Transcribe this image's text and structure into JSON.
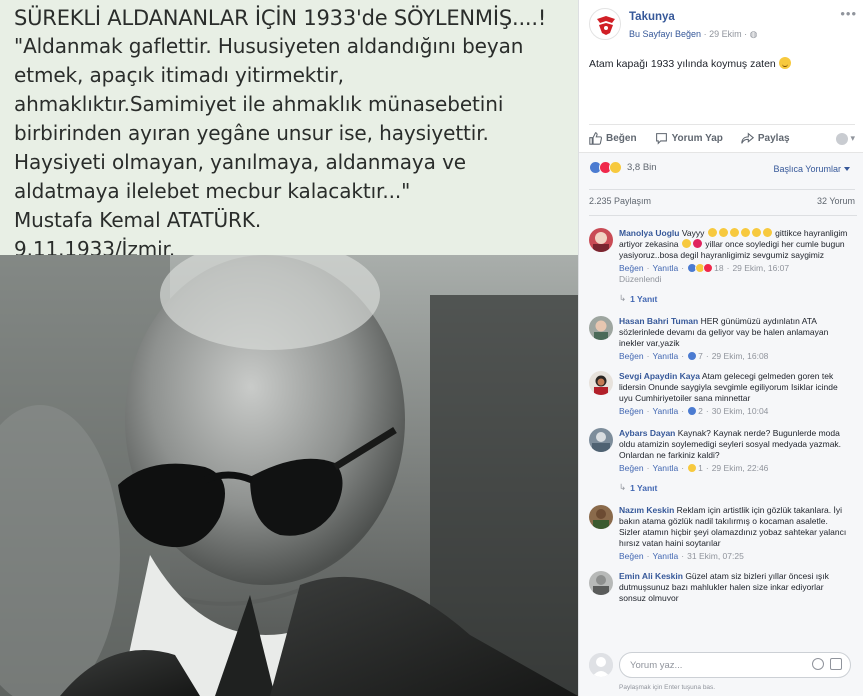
{
  "quote": {
    "heading": "SÜREKLİ ALDANANLAR İÇİN 1933'de SÖYLENMİŞ....!",
    "lines": [
      "\"Aldanmak gaflettir. Hususiyeten aldandığını beyan",
      "etmek, apaçık itimadı yitirmektir,",
      "ahmaklıktır.Samimiyet ile ahmaklık münasebetini",
      "birbirinden ayıran yegâne unsur ise, haysiyettir.",
      "Haysiyeti olmayan, yanılmaya, aldanmaya ve",
      "aldatmaya ilelebet mecbur kalacaktır...\"",
      "Mustafa Kemal ATATÜRK.",
      "9.11.1933/İzmir."
    ]
  },
  "post": {
    "page_name": "Takunya",
    "page_like": "Bu Sayfayı Beğen",
    "date": "29 Ekim",
    "text": "Atam kapağı 1933 yılında koymuş zaten",
    "actions": {
      "like": "Beğen",
      "comment": "Yorum Yap",
      "share": "Paylaş"
    },
    "reaction_count": "3,8 Bin",
    "sort_label": "Başlıca Yorumlar",
    "shares": "2.235 Paylaşım",
    "comments_count": "32 Yorum",
    "composer_placeholder": "Yorum yaz...",
    "composer_hint": "Paylaşmak için Enter tuşuna bas."
  },
  "comments": [
    {
      "author": "Manolya Uoglu",
      "text_a": "Vayyy",
      "text_b": "gittikce hayranligim artiyor zekasina",
      "text_c": "yillar once soyledigi her cumle bugun yasiyoruz..bosa degil hayranligimiz sevgumiz saygimiz",
      "like": "Beğen",
      "reply": "Yanıtla",
      "reactions": "18",
      "time": "29 Ekim, 16:07",
      "edited": "Düzenlendi",
      "replies": "1 Yanıt"
    },
    {
      "author": "Hasan Bahri Tuman",
      "text": "HER günümüzü aydınlatın ATA sözlerinlede devamı da geliyor vay be halen anlamayan inekler var,yazik",
      "like": "Beğen",
      "reply": "Yanıtla",
      "reactions": "7",
      "time": "29 Ekim, 16:08"
    },
    {
      "author": "Sevgi Apaydin Kaya",
      "text": "Atam gelecegi gelmeden goren tek lidersin Onunde saygiyla sevgimle egiliyorum Isiklar icinde uyu Cumhiriyetoiler sana minnettar",
      "like": "Beğen",
      "reply": "Yanıtla",
      "reactions": "2",
      "time": "30 Ekim, 10:04"
    },
    {
      "author": "Aybars Dayan",
      "text": "Kaynak? Kaynak nerde? Bugunlerde moda oldu atamizin soylemedigi seyleri sosyal medyada yazmak. Onlardan ne farkiniz kaldi?",
      "like": "Beğen",
      "reply": "Yanıtla",
      "reactions": "1",
      "time": "29 Ekim, 22:46",
      "replies": "1 Yanıt"
    },
    {
      "author": "Nazım Keskin",
      "text": "Reklam için artistlik için gözlük takanlara. İyi bakın atama gözlük nadil takılırmış o kocaman asaletle. Sizler atamın hiçbir şeyi olamazdınız yobaz sahtekar yalancı hırsız vatan haini soytarılar",
      "like": "Beğen",
      "reply": "Yanıtla",
      "time": "31 Ekim, 07:25"
    },
    {
      "author": "Emin Ali Keskin",
      "text": "Güzel atam siz bizleri yıllar öncesi ışık dutmuşsunuz bazı mahlukler halen size inkar ediyorlar sonsuz olmuyor"
    }
  ],
  "colors": {
    "link": "#365899",
    "muted": "#90949c",
    "feedback_bg": "#f6f7f9",
    "quote_bg": "#e8efe5"
  },
  "icons": [
    "page-logo-icon",
    "like-icon",
    "comment-icon",
    "share-icon",
    "more-icon",
    "globe-icon"
  ]
}
